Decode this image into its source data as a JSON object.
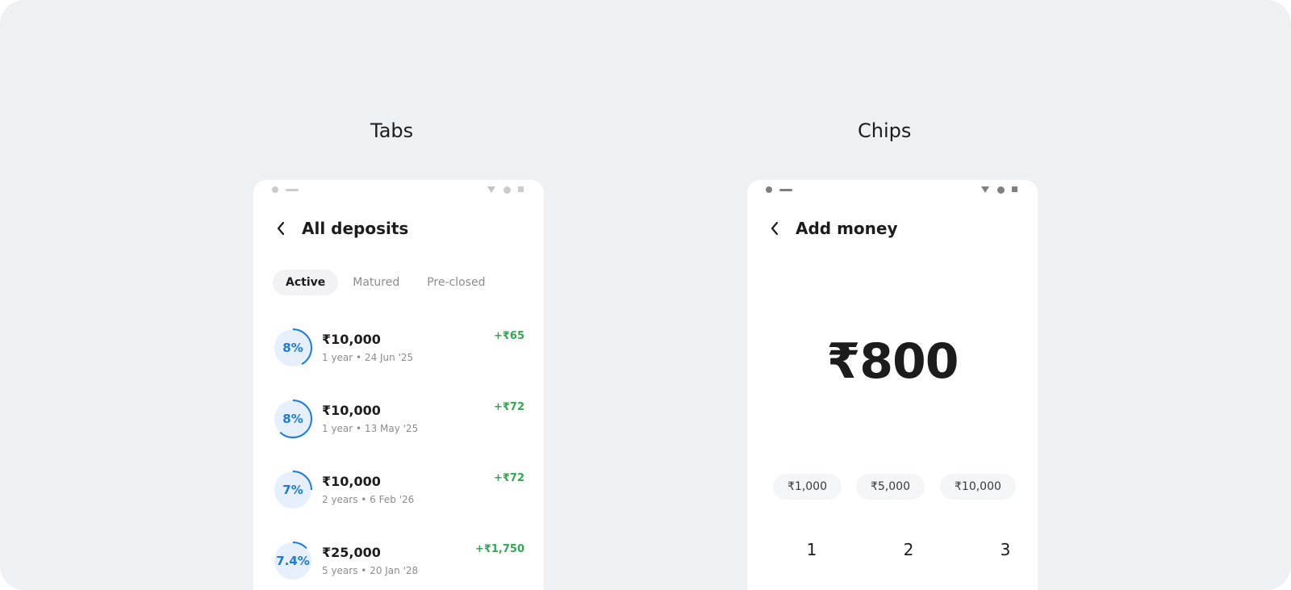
{
  "sections": {
    "tabs_title": "Tabs",
    "chips_title": "Chips"
  },
  "deposits_screen": {
    "title": "All deposits",
    "tabs": [
      "Active",
      "Matured",
      "Pre-closed"
    ],
    "active_tab": "Active",
    "deposits": [
      {
        "rate": "8%",
        "amount": "₹10,000",
        "details": "1 year • 24 Jun '25",
        "gain": "+₹65",
        "progress": 0.42
      },
      {
        "rate": "8%",
        "amount": "₹10,000",
        "details": "1 year • 13 May '25",
        "gain": "+₹72",
        "progress": 0.62
      },
      {
        "rate": "7%",
        "amount": "₹10,000",
        "details": "2 years • 6 Feb '26",
        "gain": "+₹72",
        "progress": 0.25
      },
      {
        "rate": "7.4%",
        "amount": "₹25,000",
        "details": "5 years • 20 Jan '28",
        "gain": "+₹1,750",
        "progress": 0.13
      }
    ]
  },
  "add_money_screen": {
    "title": "Add money",
    "amount": "₹800",
    "chips": [
      "₹1,000",
      "₹5,000",
      "₹10,000"
    ],
    "keypad": [
      "1",
      "2",
      "3"
    ]
  },
  "colors": {
    "accent": "#1a7ae0",
    "ring_fill": "#e5f0fc",
    "gain": "#2fa84f"
  },
  "icons": {
    "back": "chevron-left-icon",
    "status_wifi": "wifi-icon",
    "status_signal": "signal-icon",
    "status_battery": "battery-icon"
  }
}
